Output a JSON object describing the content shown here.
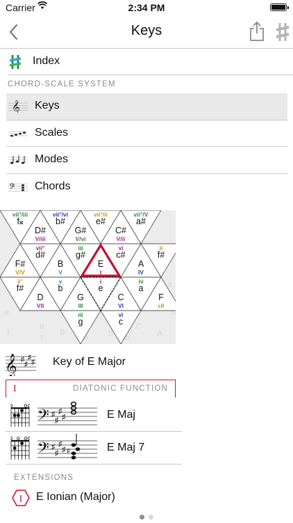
{
  "status": {
    "carrier": "Carrier",
    "time": "2:34 PM"
  },
  "nav": {
    "title": "Keys"
  },
  "index": {
    "label": "Index"
  },
  "section": {
    "title": "CHORD-SCALE SYSTEM"
  },
  "items": [
    {
      "label": "Keys",
      "icon": "treble-clef-icon",
      "selected": true
    },
    {
      "label": "Scales",
      "icon": "scale-notes-icon",
      "selected": false
    },
    {
      "label": "Modes",
      "icon": "mode-notes-icon",
      "selected": false
    },
    {
      "label": "Chords",
      "icon": "bass-clef-chord-icon",
      "selected": false
    }
  ],
  "grid": {
    "upper": [
      {
        "func": "vii°/iii",
        "fc": "#2a8a3a",
        "note": "f𝄪",
        "row": 0,
        "up": false
      },
      {
        "note": "D#",
        "func": "V/iii",
        "fc": "#a0239a",
        "row": 0,
        "up": true
      },
      {
        "func": "vii°/vi",
        "fc": "#2b3aa8",
        "note": "b#",
        "row": 0,
        "up": false
      },
      {
        "note": "G#",
        "func": "V/vi",
        "fc": "#2a8a3a",
        "row": 0,
        "up": true
      },
      {
        "func": "vii°/ii",
        "fc": "#d28c10",
        "note": "e#",
        "row": 0,
        "up": false
      },
      {
        "note": "C#",
        "func": "V/ii",
        "fc": "#a0239a",
        "row": 0,
        "up": true
      },
      {
        "func": "vii°/V",
        "fc": "#2a8a3a",
        "note": "a#",
        "row": 0,
        "up": false
      }
    ],
    "middle": [
      {
        "note": "F#",
        "func": "V/V",
        "fc": "#d28c10",
        "row": 1,
        "up": true
      },
      {
        "func": "vii°",
        "fc": "#a0239a",
        "note": "d#",
        "row": 1,
        "up": false
      },
      {
        "note": "B",
        "func": "V",
        "fc": "#1f8fd0",
        "row": 1,
        "up": true
      },
      {
        "func": "iii",
        "fc": "#2a8a3a",
        "note": "g#",
        "row": 1,
        "up": false
      },
      {
        "note": "E",
        "func": "I",
        "fc": "#c8102e",
        "row": 1,
        "up": true
      },
      {
        "func": "vi",
        "fc": "#a0239a",
        "note": "c#",
        "row": 1,
        "up": false
      },
      {
        "note": "A",
        "func": "IV",
        "fc": "#2b3aa8",
        "row": 1,
        "up": true
      },
      {
        "func": "ii",
        "fc": "#d28c10",
        "note": "f#",
        "row": 1,
        "up": false
      }
    ],
    "lower": [
      {
        "func": "ii°",
        "fc": "#d28c10",
        "note": "f#",
        "row": 2,
        "up": false
      },
      {
        "note": "D",
        "func": "VII",
        "fc": "#a0239a",
        "row": 2,
        "up": true
      },
      {
        "func": "v",
        "fc": "#1f8fd0",
        "note": "b",
        "row": 2,
        "up": false
      },
      {
        "note": "G",
        "func": "III",
        "fc": "#2a8a3a",
        "row": 2,
        "up": true
      },
      {
        "func": "i",
        "fc": "#c8102e",
        "note": "e",
        "row": 2,
        "up": false
      },
      {
        "note": "C",
        "func": "VI",
        "fc": "#2b3aa8",
        "row": 2,
        "up": true
      },
      {
        "func": "iv",
        "fc": "#2a8a3a",
        "note": "a",
        "row": 2,
        "up": false
      },
      {
        "note": "F",
        "func": "♭II",
        "fc": "#d28c10",
        "row": 2,
        "up": true
      }
    ],
    "bottom": [
      {
        "func": "iii",
        "fc": "#2a8a3a",
        "note": "g"
      },
      {
        "func": "vi",
        "fc": "#2b3aa8",
        "note": "c"
      }
    ],
    "ghost": [
      "f",
      "d",
      "B",
      "E",
      "C",
      "A",
      "F",
      "d",
      "a",
      "c",
      "Eb",
      "B",
      "Ab",
      "f",
      "e"
    ]
  },
  "key": {
    "label": "Key of E Major"
  },
  "diatonic": {
    "roman": "I",
    "label": "DIATONIC FUNCTION"
  },
  "chords": [
    {
      "label": "E Maj"
    },
    {
      "label": "E Maj 7"
    }
  ],
  "extensions": {
    "title": "EXTENSIONS",
    "items": [
      {
        "label": "E Ionian (Major)",
        "badge": "I"
      }
    ]
  },
  "pager": {
    "count": 2,
    "current": 1
  }
}
